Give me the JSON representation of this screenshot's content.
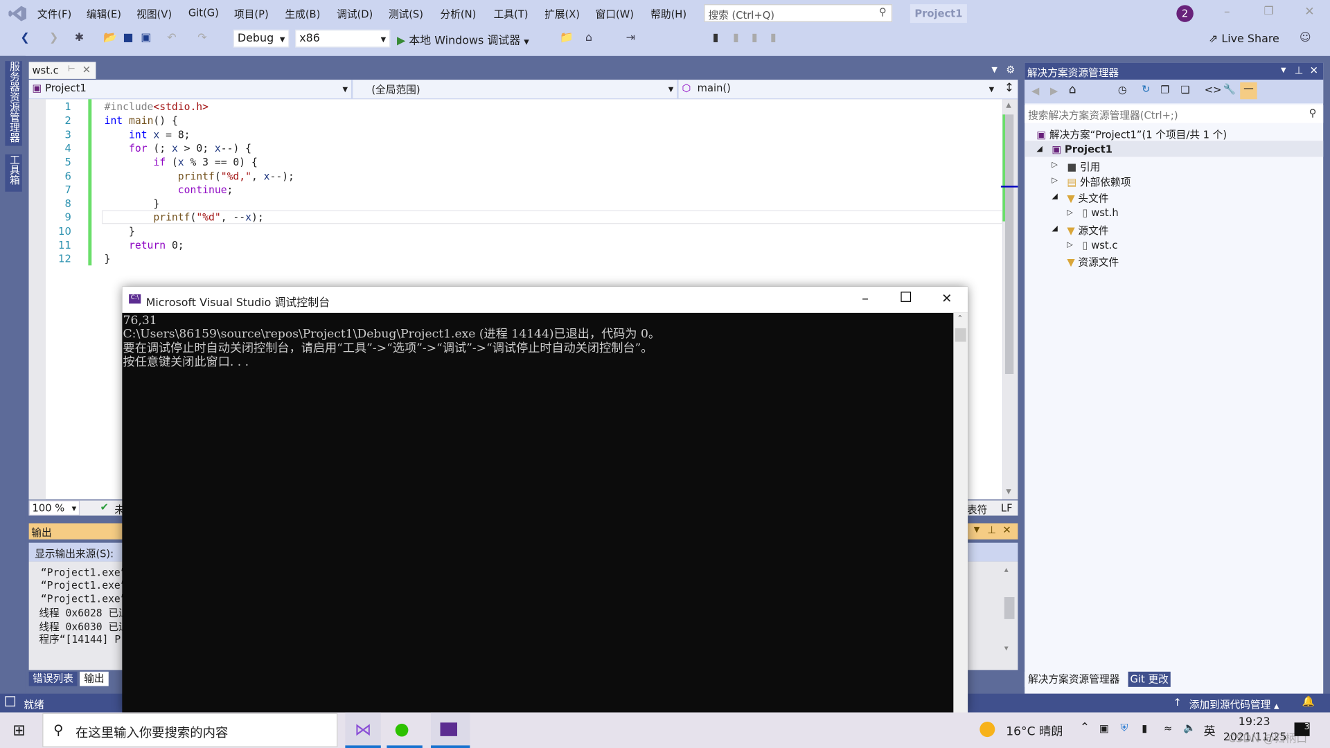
{
  "menu": [
    "文件(F)",
    "编辑(E)",
    "视图(V)",
    "Git(G)",
    "项目(P)",
    "生成(B)",
    "调试(D)",
    "测试(S)",
    "分析(N)",
    "工具(T)",
    "扩展(X)",
    "窗口(W)",
    "帮助(H)"
  ],
  "search": {
    "placeholder": "搜索 (Ctrl+Q)"
  },
  "project_badge": "Project1",
  "notification_count": "2",
  "toolbar": {
    "config": "Debug",
    "platform": "x86",
    "run_label": "本地 Windows 调试器",
    "live_share": "Live Share"
  },
  "left_tabs": [
    "服务器资源管理器",
    "工具箱"
  ],
  "editor": {
    "tab": "wst.c",
    "nav": {
      "project": "Project1",
      "scope": "(全局范围)",
      "member": "main()"
    },
    "lines": [
      {
        "n": "1",
        "html": "<span class='pp'>#include</span><span class='st'>&lt;stdio.h&gt;</span>"
      },
      {
        "n": "2",
        "html": "<span class='kw'>int</span> <span class='fn'>main</span>() {"
      },
      {
        "n": "3",
        "html": "    <span class='kw'>int</span> <span class='var'>x</span> = 8;"
      },
      {
        "n": "4",
        "html": "    <span class='kp'>for</span> (; <span class='var'>x</span> &gt; 0; <span class='var'>x</span>--) {"
      },
      {
        "n": "5",
        "html": "        <span class='kp'>if</span> (<span class='var'>x</span> % 3 == 0) {"
      },
      {
        "n": "6",
        "html": "            <span class='fn'>printf</span>(<span class='st'>\"%d,\"</span>, <span class='var'>x</span>--);"
      },
      {
        "n": "7",
        "html": "            <span class='kp'>continue</span>;"
      },
      {
        "n": "8",
        "html": "        }"
      },
      {
        "n": "9",
        "html": "        <span class='fn'>printf</span>(<span class='st'>\"%d\"</span>, --<span class='var'>x</span>);"
      },
      {
        "n": "10",
        "html": "    }"
      },
      {
        "n": "11",
        "html": "    <span class='kp'>return</span> 0;"
      },
      {
        "n": "12",
        "html": "}"
      }
    ],
    "zoom": "100 %",
    "issues_partial": "未",
    "encoding_partial": "表符",
    "line_ending": "LF"
  },
  "output": {
    "title": "输出",
    "source_label": "显示输出来源(S):",
    "lines": [
      "“Project1.exe”",
      "“Project1.exe”",
      "“Project1.exe”",
      "线程 0x6028 已退",
      "线程 0x6030 已退",
      "程序“[14144] P"
    ],
    "tabs": [
      "错误列表",
      "输出"
    ]
  },
  "console": {
    "title": "Microsoft Visual Studio 调试控制台",
    "text": "76,31\nC:\\Users\\86159\\source\\repos\\Project1\\Debug\\Project1.exe (进程 14144)已退出，代码为 0。\n要在调试停止时自动关闭控制台，请启用“工具”->“选项”->“调试”->“调试停止时自动关闭控制台”。\n按任意键关闭此窗口. . ."
  },
  "solution_explorer": {
    "title": "解决方案资源管理器",
    "search_placeholder": "搜索解决方案资源管理器(Ctrl+;)",
    "tree": [
      "解决方案“Project1”(1 个项目/共 1 个)",
      "Project1",
      "引用",
      "外部依赖项",
      "头文件",
      "wst.h",
      "源文件",
      "wst.c",
      "资源文件"
    ],
    "tabs": [
      "解决方案资源管理器",
      "Git 更改"
    ]
  },
  "status": {
    "ready": "就绪",
    "source_control": "添加到源代码管理"
  },
  "taskbar": {
    "search_placeholder": "在这里输入你要搜索的内容",
    "weather": "16°C  晴朗",
    "ime": "英",
    "time": "19:23",
    "date": "2021/11/25",
    "watermark": "CSDN @归柄口",
    "notif": "3"
  },
  "colors": {
    "accent": "#40508d",
    "chrome": "#ccd5f0",
    "background": "#5d6b99",
    "output_header": "#f5cc84",
    "console_bg": "#0c0c0c"
  }
}
